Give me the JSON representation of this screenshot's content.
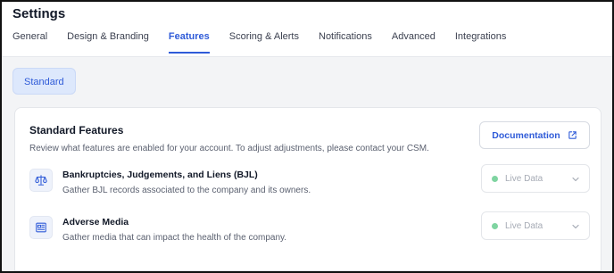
{
  "page": {
    "title": "Settings"
  },
  "tabs": [
    {
      "label": "General"
    },
    {
      "label": "Design & Branding"
    },
    {
      "label": "Features"
    },
    {
      "label": "Scoring & Alerts"
    },
    {
      "label": "Notifications"
    },
    {
      "label": "Advanced"
    },
    {
      "label": "Integrations"
    }
  ],
  "active_tab": "Features",
  "subtab": {
    "label": "Standard"
  },
  "card": {
    "title": "Standard Features",
    "description": "Review what features are enabled for your account. To adjust adjustments, please contact your CSM.",
    "doc_button": "Documentation"
  },
  "features": [
    {
      "name": "Bankruptcies, Judgements, and Liens (BJL)",
      "description": "Gather BJL records associated to the company and its owners.",
      "icon": "scales-icon",
      "status": "Live Data"
    },
    {
      "name": "Adverse Media",
      "description": "Gather media that can impact the health of the company.",
      "icon": "newspaper-icon",
      "status": "Live Data"
    }
  ],
  "colors": {
    "accent": "#2f5bd8",
    "status_live": "#7fd4a1"
  }
}
